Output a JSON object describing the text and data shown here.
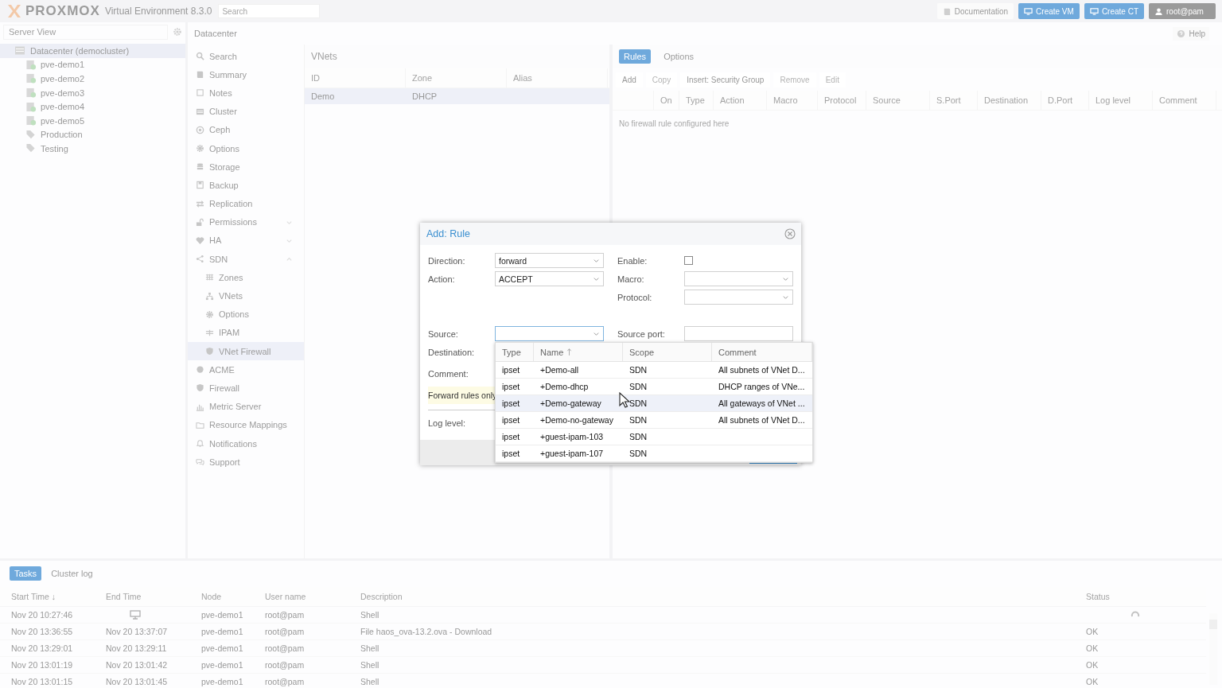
{
  "header": {
    "logo": "PROXMOX",
    "product": "Virtual Environment 8.3.0",
    "search": {
      "placeholder": "Search"
    },
    "buttons": [
      {
        "label": "Documentation",
        "kind": "plain"
      },
      {
        "label": "Create VM",
        "kind": "primary"
      },
      {
        "label": "Create CT",
        "kind": "primary"
      },
      {
        "label": "root@pam",
        "kind": "user"
      }
    ]
  },
  "resource_tree": {
    "view": "Server View",
    "items": [
      {
        "label": "Datacenter (democluster)",
        "selected": true,
        "children": [
          {
            "label": "pve-demo1",
            "kind": "node"
          },
          {
            "label": "pve-demo2",
            "kind": "node"
          },
          {
            "label": "pve-demo3",
            "kind": "node"
          },
          {
            "label": "pve-demo4",
            "kind": "node"
          },
          {
            "label": "pve-demo5",
            "kind": "node"
          },
          {
            "label": "Production",
            "kind": "tag"
          },
          {
            "label": "Testing",
            "kind": "tag"
          }
        ]
      }
    ]
  },
  "content": {
    "title": "Datacenter",
    "help": "Help"
  },
  "nav": [
    {
      "label": "Search",
      "selected": false
    },
    {
      "label": "Summary",
      "selected": false
    },
    {
      "label": "Notes",
      "selected": false
    },
    {
      "label": "Cluster",
      "selected": false
    },
    {
      "label": "Ceph",
      "selected": false
    },
    {
      "label": "Options",
      "selected": false
    },
    {
      "label": "Storage",
      "selected": false
    },
    {
      "label": "Backup",
      "selected": false
    },
    {
      "label": "Replication",
      "selected": false
    },
    {
      "label": "Permissions",
      "selected": false,
      "expanded": false
    },
    {
      "label": "HA",
      "selected": false,
      "expanded": false
    },
    {
      "label": "SDN",
      "selected": false,
      "expanded": true,
      "children": [
        {
          "label": "Zones",
          "selected": false
        },
        {
          "label": "VNets",
          "selected": false
        },
        {
          "label": "Options",
          "selected": false
        },
        {
          "label": "IPAM",
          "selected": false
        },
        {
          "label": "VNet Firewall",
          "selected": true
        }
      ]
    },
    {
      "label": "ACME",
      "selected": false
    },
    {
      "label": "Firewall",
      "selected": false
    },
    {
      "label": "Metric Server",
      "selected": false
    },
    {
      "label": "Resource Mappings",
      "selected": false
    },
    {
      "label": "Notifications",
      "selected": false
    },
    {
      "label": "Support",
      "selected": false
    }
  ],
  "vnets": {
    "title": "VNets",
    "columns": [
      "ID",
      "Zone",
      "Alias"
    ],
    "rows": [
      {
        "cells": [
          "Demo",
          "DHCP"
        ],
        "selected": true
      }
    ]
  },
  "firewall": {
    "tabs": [
      {
        "label": "Rules",
        "selected": true
      },
      {
        "label": "Options",
        "selected": false
      }
    ],
    "toolbar": [
      {
        "label": "Add",
        "disabled": false
      },
      {
        "label": "Copy",
        "disabled": true
      },
      {
        "label": "Insert: Security Group",
        "disabled": false
      },
      {
        "label": "Remove",
        "disabled": true
      },
      {
        "label": "Edit",
        "disabled": true
      }
    ],
    "columns": [
      "On",
      "Type",
      "Action",
      "Macro",
      "Protocol",
      "Source",
      "S.Port",
      "Destination",
      "D.Port",
      "Log level",
      "Comment"
    ],
    "empty_text": "No firewall rule configured here"
  },
  "dialog": {
    "title": "Add: Rule",
    "left_fields": [
      {
        "label": "Direction:",
        "value": "forward",
        "kind": "combo"
      },
      {
        "label": "Action:",
        "value": "ACCEPT",
        "kind": "combo"
      }
    ],
    "right_fields": [
      {
        "label": "Enable:",
        "kind": "checkbox",
        "checked": false
      },
      {
        "label": "Macro:",
        "kind": "combo"
      },
      {
        "label": "Protocol:",
        "kind": "combo"
      }
    ],
    "source": {
      "label": "Source:",
      "focused": true
    },
    "source_port": {
      "label": "Source port:"
    },
    "destination_label": "Destination:",
    "comment_label": "Comment:",
    "hint": "Forward rules only",
    "log_level_label": "Log level:",
    "dropdown": {
      "columns": [
        {
          "label": "Type",
          "sorted": false
        },
        {
          "label": "Name",
          "sorted": true
        },
        {
          "label": "Scope",
          "sorted": false
        },
        {
          "label": "Comment",
          "sorted": false
        }
      ],
      "rows": [
        {
          "cells": [
            "ipset",
            "+Demo-all",
            "SDN",
            "All subnets of VNet D..."
          ],
          "highlighted": false
        },
        {
          "cells": [
            "ipset",
            "+Demo-dhcp",
            "SDN",
            "DHCP ranges of VNe..."
          ],
          "highlighted": false
        },
        {
          "cells": [
            "ipset",
            "+Demo-gateway",
            "SDN",
            "All gateways of VNet ..."
          ],
          "highlighted": true
        },
        {
          "cells": [
            "ipset",
            "+Demo-no-gateway",
            "SDN",
            "All subnets of VNet D..."
          ],
          "highlighted": false
        },
        {
          "cells": [
            "ipset",
            "+guest-ipam-103",
            "SDN"
          ],
          "highlighted": false
        },
        {
          "cells": [
            "ipset",
            "+guest-ipam-107",
            "SDN"
          ],
          "highlighted": false
        }
      ]
    }
  },
  "tasks": {
    "tabs": [
      {
        "label": "Tasks",
        "selected": true
      },
      {
        "label": "Cluster log",
        "selected": false
      }
    ],
    "columns": [
      "Start Time ↓",
      "End Time",
      "Node",
      "User name",
      "Description",
      "Status"
    ],
    "rows": [
      {
        "start": "Nov 20 10:27:46",
        "running": true,
        "node": "pve-demo1",
        "user": "root@pam",
        "description": "Shell"
      },
      {
        "start": "Nov 20 13:36:55",
        "end": "Nov 20 13:37:07",
        "running": false,
        "node": "pve-demo1",
        "user": "root@pam",
        "description": "File haos_ova-13.2.ova - Download",
        "status": "OK"
      },
      {
        "start": "Nov 20 13:29:01",
        "end": "Nov 20 13:29:11",
        "running": false,
        "node": "pve-demo1",
        "user": "root@pam",
        "description": "Shell",
        "status": "OK"
      },
      {
        "start": "Nov 20 13:01:19",
        "end": "Nov 20 13:01:42",
        "running": false,
        "node": "pve-demo1",
        "user": "root@pam",
        "description": "Shell",
        "status": "OK"
      },
      {
        "start": "Nov 20 13:01:15",
        "end": "Nov 20 13:01:45",
        "running": false,
        "node": "pve-demo1",
        "user": "root@pam",
        "description": "Shell",
        "status": "OK"
      }
    ]
  }
}
